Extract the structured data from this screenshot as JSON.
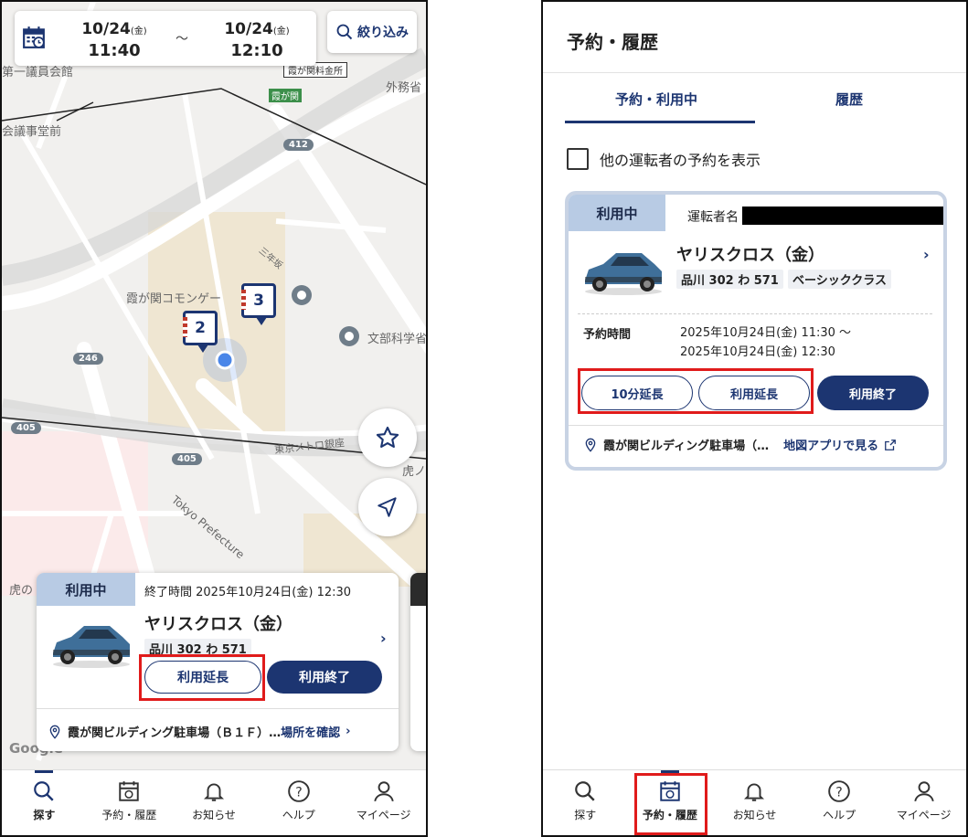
{
  "left": {
    "datebar": {
      "start_date": "10/24",
      "start_dow": "(金)",
      "start_time": "11:40",
      "separator": "〜",
      "end_date": "10/24",
      "end_dow": "(金)",
      "end_time": "12:10"
    },
    "filter_label": "絞り込み",
    "map_labels": {
      "l1": "第一議員会館",
      "l2": "霞が関料金所",
      "l3": "霞が関",
      "l4": "外務省",
      "l5": "会議事堂前",
      "l6": "霞が関コモンゲー",
      "l7": "文部科学省",
      "l8": "三年坂",
      "l9": "東京メトロ銀座",
      "l10": "Tokyo Prefecture",
      "l11": "虎ノ",
      "l12": "虎の",
      "l13": "Google"
    },
    "road_numbers": {
      "r1": "412",
      "r2": "246",
      "r3": "405",
      "r4": "405"
    },
    "pins": {
      "p1": "2",
      "p2": "3"
    },
    "card": {
      "status": "利用中",
      "end_time": "終了時間 2025年10月24日(金) 12:30",
      "car_name": "ヤリスクロス（金）",
      "plate": "品川 302 わ 571",
      "extend_label": "利用延長",
      "finish_label": "利用終了",
      "location": "霞が関ビルディング駐車場（Ｂ１Ｆ）…",
      "location_link": "場所を確認"
    },
    "tabs": [
      {
        "label": "探す",
        "icon": "search-icon"
      },
      {
        "label": "予約・履歴",
        "icon": "calendar-icon"
      },
      {
        "label": "お知らせ",
        "icon": "bell-icon"
      },
      {
        "label": "ヘルプ",
        "icon": "help-icon"
      },
      {
        "label": "マイページ",
        "icon": "person-icon"
      }
    ]
  },
  "right": {
    "title": "予約・履歴",
    "tab_active": "予約・利用中",
    "tab_history": "履歴",
    "checkbox_label": "他の運転者の予約を表示",
    "card": {
      "status": "利用中",
      "driver_label": "運転者名",
      "car_name": "ヤリスクロス（金）",
      "plate": "品川 302 わ 571",
      "car_class": "ベーシッククラス",
      "time_label": "予約時間",
      "time_start": "2025年10月24日(金) 11:30 〜",
      "time_end": "2025年10月24日(金) 12:30",
      "extend10_label": "10分延長",
      "extend_label": "利用延長",
      "finish_label": "利用終了",
      "location": "霞が関ビルディング駐車場（…",
      "map_link": "地図アプリで見る"
    },
    "tabs": [
      {
        "label": "探す",
        "icon": "search-icon"
      },
      {
        "label": "予約・履歴",
        "icon": "calendar-icon"
      },
      {
        "label": "お知らせ",
        "icon": "bell-icon"
      },
      {
        "label": "ヘルプ",
        "icon": "help-icon"
      },
      {
        "label": "マイページ",
        "icon": "person-icon"
      }
    ]
  },
  "colors": {
    "accent": "#1c3571",
    "badge": "#b8cbe4",
    "highlight": "#e01b1b"
  }
}
